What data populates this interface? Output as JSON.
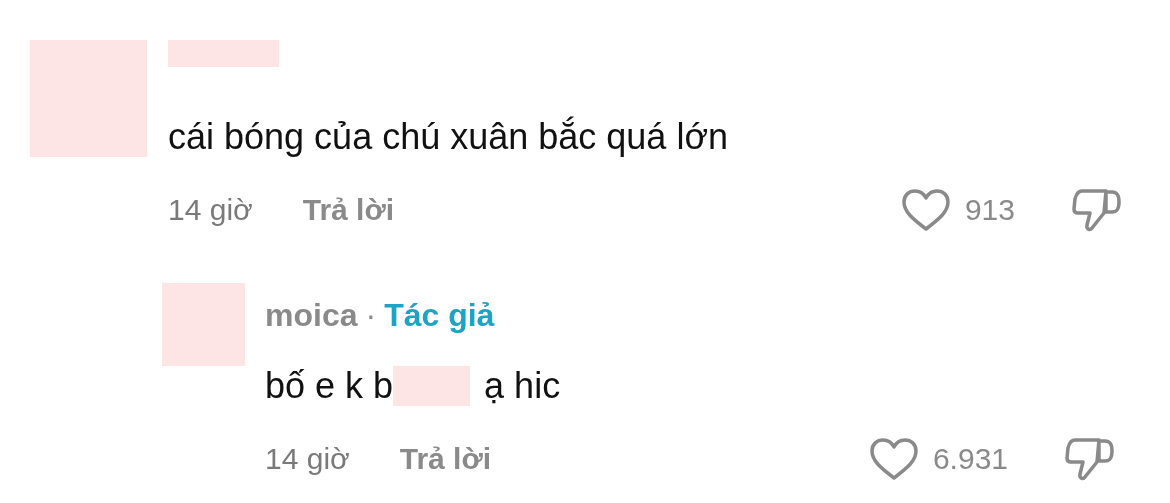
{
  "comments": [
    {
      "author": {
        "redacted": true
      },
      "text_segments": [
        {
          "kind": "text",
          "text": "cái bóng của chú xuân bắc quá lớn"
        }
      ],
      "time": "14 giờ",
      "reply_label": "Trả lời",
      "liked": false,
      "likes": "913",
      "replies": [
        {
          "author": {
            "name": "moica",
            "separator": "·",
            "badge": "Tác giả"
          },
          "text_segments": [
            {
              "kind": "text",
              "text": "bố e k b"
            },
            {
              "kind": "redacted"
            },
            {
              "kind": "text",
              "text": "ạ hic"
            }
          ],
          "time": "14 giờ",
          "reply_label": "Trả lời",
          "liked": false,
          "likes": "6.931"
        }
      ]
    }
  ]
}
